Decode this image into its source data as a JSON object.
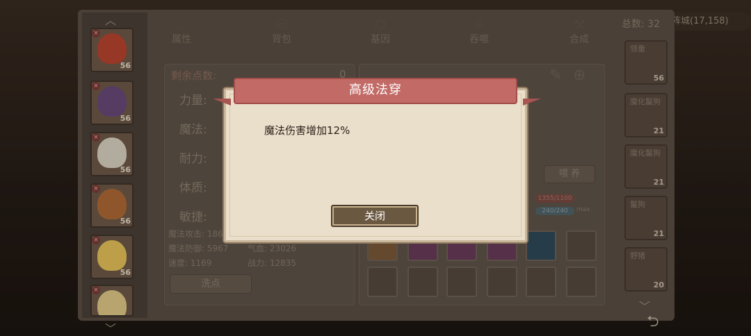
{
  "background": {
    "top_right_badge": "阵城(17,158)",
    "left_partial_lines": [
      "",
      "",
      ""
    ]
  },
  "heroes": {
    "levels": [
      "56",
      "56",
      "56",
      "56",
      "56",
      "56"
    ],
    "face_colors": [
      "#b9442f",
      "#6a4a78",
      "#d9d2c2",
      "#b06a35",
      "#e8c35a",
      "#e1c987"
    ]
  },
  "tabs": [
    {
      "label": "属性",
      "icon": "flame-icon"
    },
    {
      "label": "背包",
      "icon": "bag-icon"
    },
    {
      "label": "基因",
      "icon": "dna-icon"
    },
    {
      "label": "吞噬",
      "icon": "skull-icon"
    },
    {
      "label": "合成",
      "icon": "hammer-icon"
    }
  ],
  "stats": {
    "remaining_label": "剩余点数:",
    "remaining_value": "0",
    "rows": [
      "力量:",
      "魔法:",
      "耐力:",
      "体质:",
      "敏捷:"
    ],
    "magic_attack": "魔法攻击: 1868",
    "magic_defense": "魔法防御: 5967",
    "hp": "气血: 23026",
    "speed": "速度: 1169",
    "power": "战力: 12835",
    "reset_button": "洗点"
  },
  "right_panel": {
    "feed_button": "喂 养",
    "bar1_text": "1355/1100",
    "bar2_text": "240/240",
    "bar2_suffix": "max"
  },
  "enemies": {
    "total_label": "总数: 32",
    "cards": [
      {
        "name": "领重",
        "level": "56"
      },
      {
        "name": "魔化鬣狗",
        "level": "21"
      },
      {
        "name": "魔化鬣狗",
        "level": "21"
      },
      {
        "name": "鬣狗",
        "level": "21"
      },
      {
        "name": "野猪",
        "level": "20"
      }
    ]
  },
  "dialog": {
    "title": "高级法穿",
    "body": "魔法伤害增加12%",
    "close_button": "关闭"
  },
  "colors": {
    "ribbon": "#c26a66",
    "dialog_bg": "#eadfcb",
    "button_bg": "#6b5841"
  }
}
